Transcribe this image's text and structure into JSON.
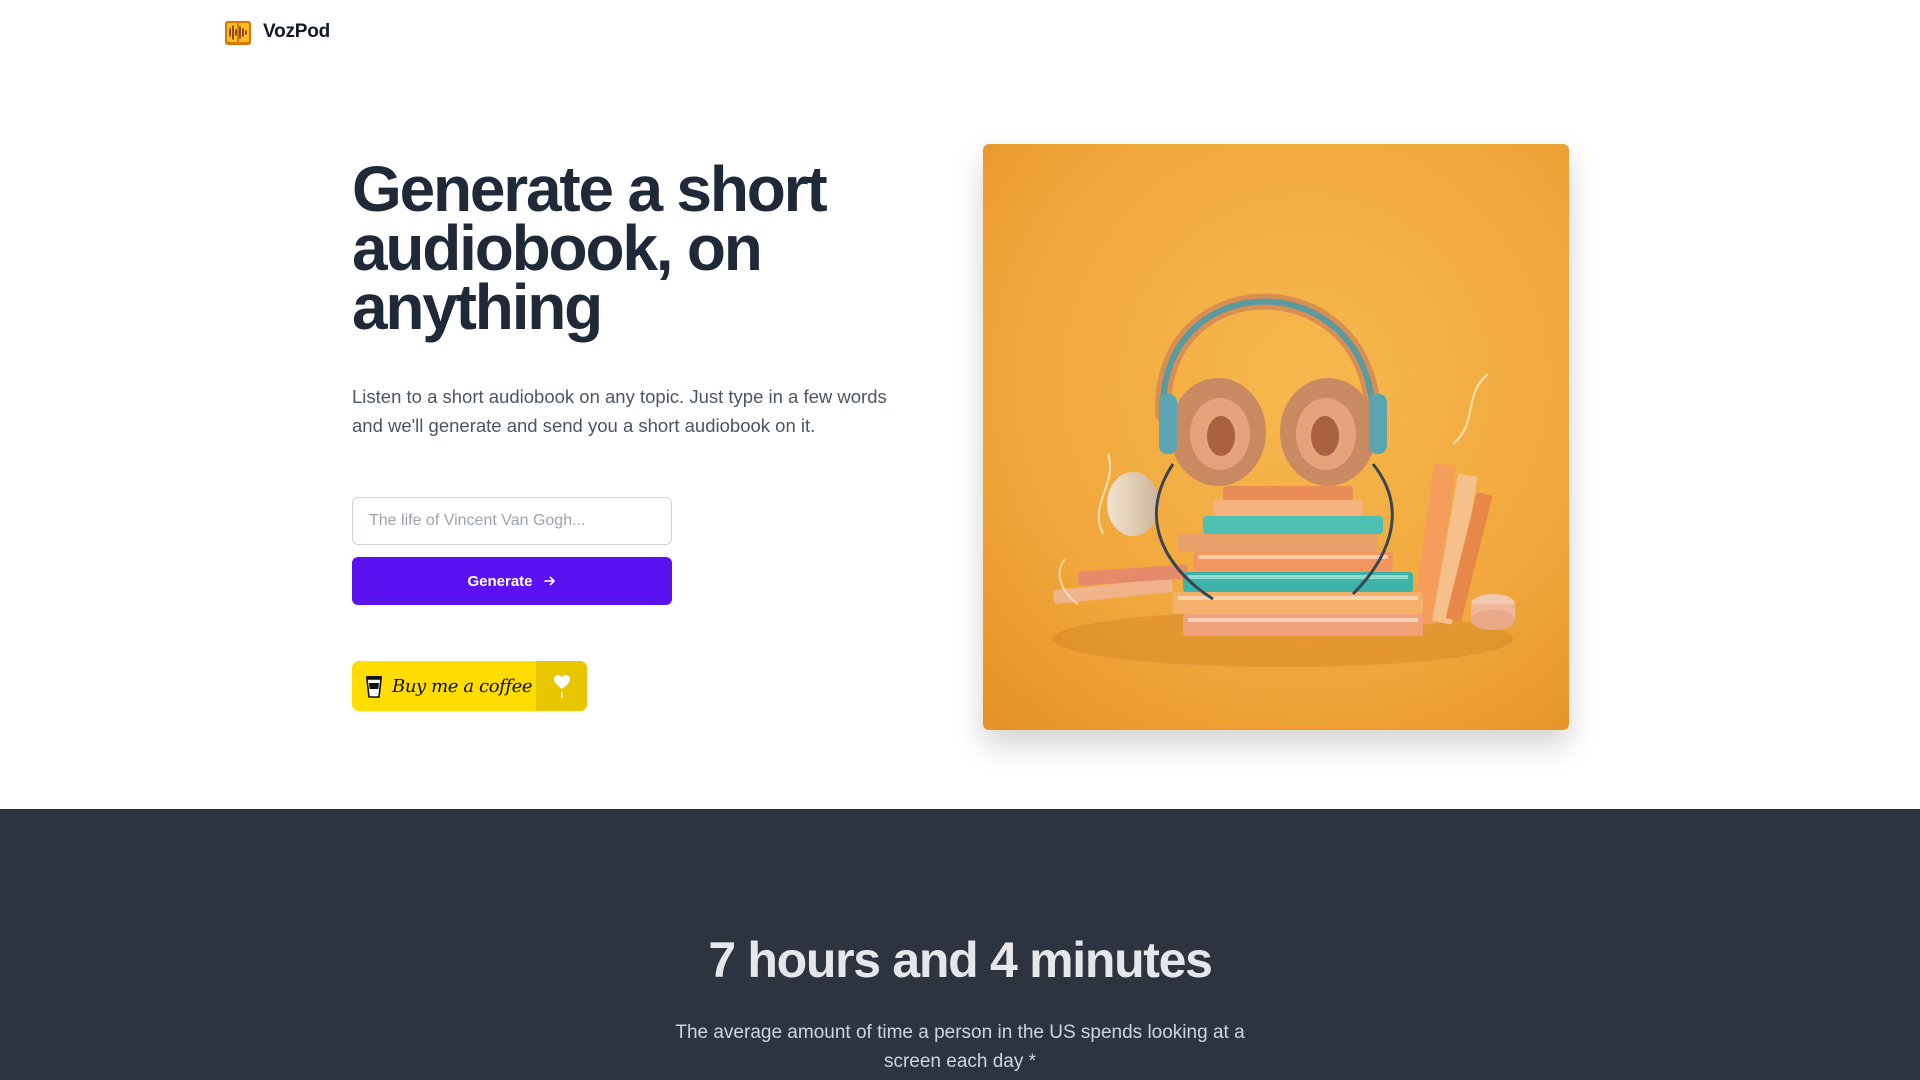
{
  "header": {
    "brand": "VozPod",
    "logo_icon": "soundwave-book-icon"
  },
  "hero": {
    "title": "Generate a short audiobook, on anything",
    "subtitle": "Listen to a short audiobook on any topic. Just type in a few words and we'll generate and send you a short audiobook on it.",
    "topic_input": {
      "value": "",
      "placeholder": "The life of Vincent Van Gogh..."
    },
    "generate_label": "Generate",
    "generate_icon": "arrow-right-icon",
    "coffee_label": "Buy me a coffee",
    "image_subject": "headphones-on-books-illustration"
  },
  "stats": {
    "headline": "7 hours and 4 minutes",
    "description": "The average amount of time a person in the US spends looking at a screen each day *"
  },
  "colors": {
    "primary": "#5b12f0",
    "coffee_yellow": "#ffdd00",
    "dark_band": "#2d3440",
    "heading": "#1f2937",
    "hero_image_bg": "#f0a938"
  }
}
